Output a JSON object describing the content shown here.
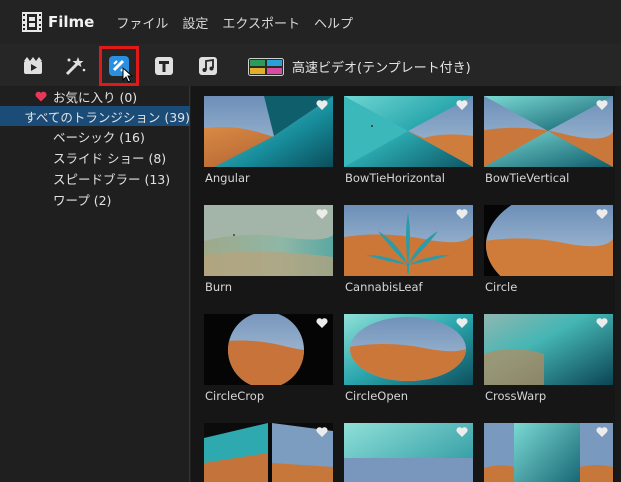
{
  "app": {
    "name": "Filme"
  },
  "menu": [
    "ファイル",
    "設定",
    "エクスポート",
    "ヘルプ"
  ],
  "toolbar": {
    "tools": [
      "media-icon",
      "effects-icon",
      "transitions-icon",
      "text-icon",
      "music-icon"
    ],
    "active_tool": "transitions-icon",
    "preset_label": "高速ビデオ(テンプレート付き)"
  },
  "sidebar": {
    "favorites": "お気に入り (0)",
    "all": "すべてのトランジション (39)",
    "children": [
      "ベーシック (16)",
      "スライド ショー (8)",
      "スピードブラー (13)",
      "ワープ (2)"
    ]
  },
  "transitions": [
    "Angular",
    "BowTieHorizontal",
    "BowTieVertical",
    "Burn",
    "CannabisLeaf",
    "Circle",
    "CircleCrop",
    "CircleOpen",
    "CrossWarp",
    "",
    "",
    ""
  ],
  "colors": {
    "accent_red": "#e01919",
    "selection_blue": "#1b4c78",
    "sand": "#c9793a",
    "teal": "#1c9aa4"
  }
}
